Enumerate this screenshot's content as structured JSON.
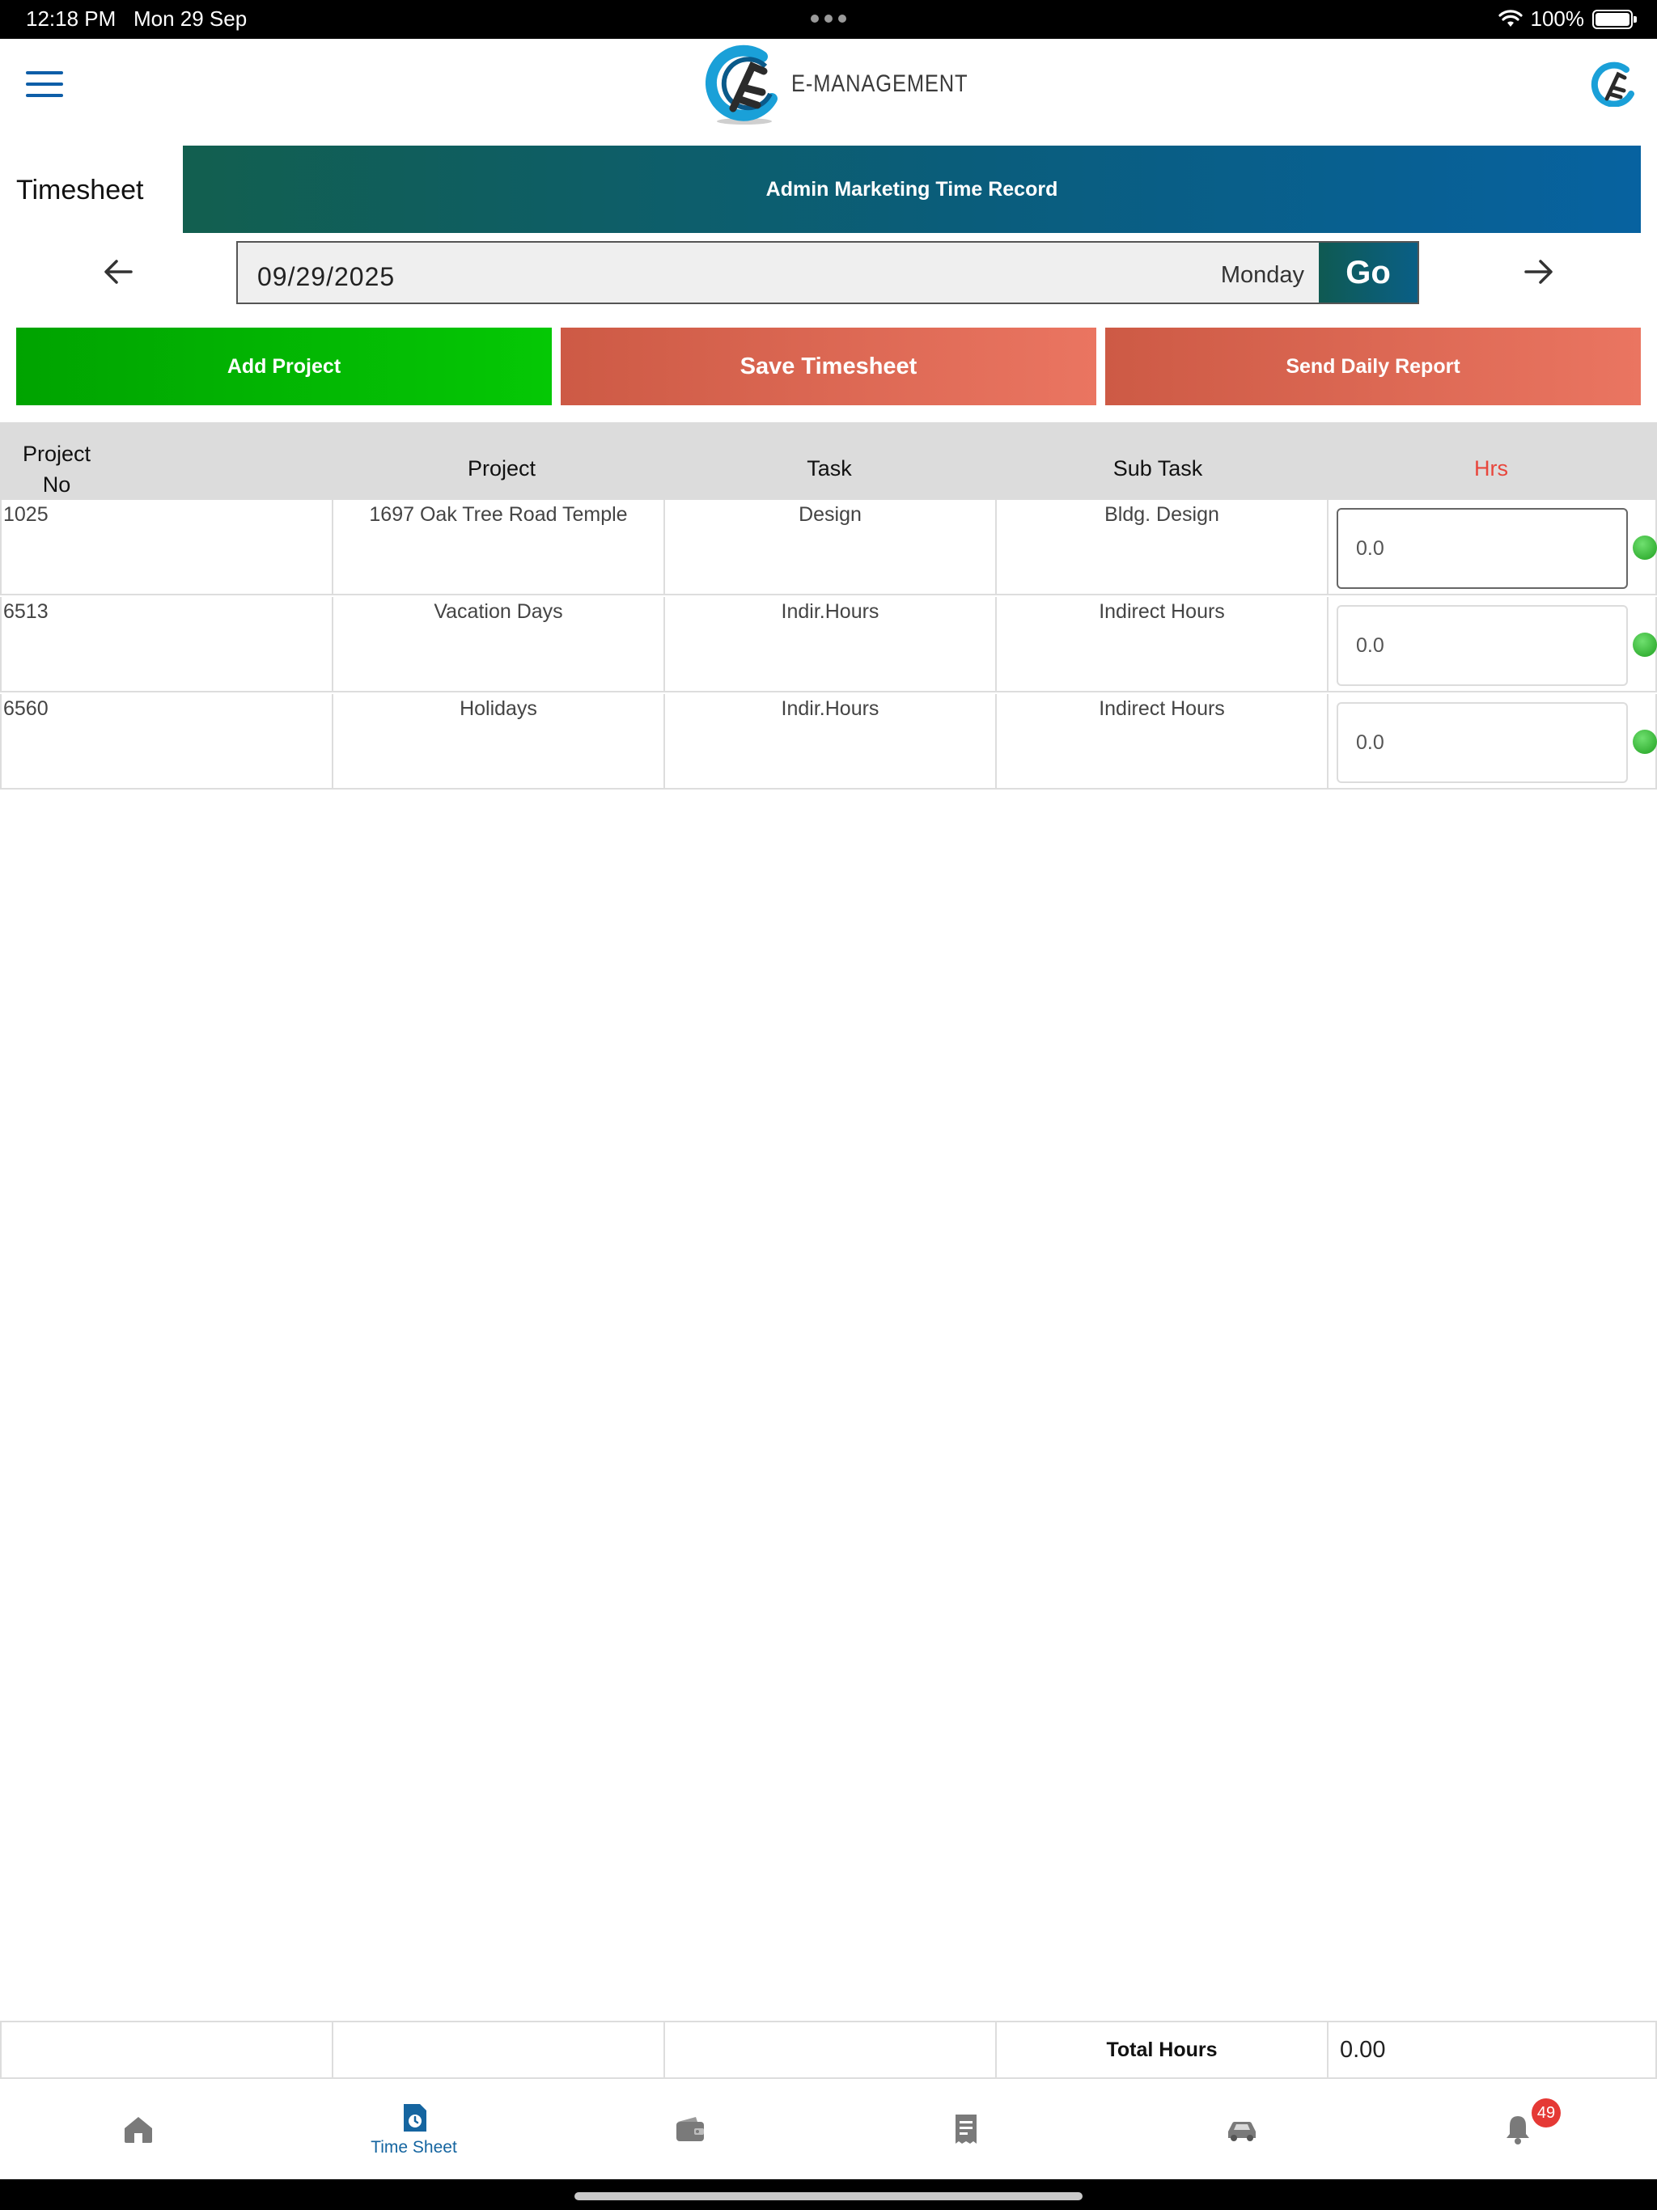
{
  "status_bar": {
    "time": "12:18 PM",
    "date": "Mon 29 Sep",
    "battery": "100%"
  },
  "header": {
    "app_name": "E-MANAGEMENT",
    "menu_icon": "hamburger-menu-icon",
    "avatar_icon": "profile-logo-icon"
  },
  "page": {
    "title": "Timesheet",
    "banner": "Admin Marketing Time Record"
  },
  "date_nav": {
    "date": "09/29/2025",
    "day": "Monday",
    "go_label": "Go",
    "prev_icon": "arrow-left-icon",
    "next_icon": "arrow-right-icon"
  },
  "actions": {
    "add_project": "Add Project",
    "save_timesheet": "Save Timesheet",
    "send_report": "Send Daily Report"
  },
  "table": {
    "headers": {
      "project_no_line1": "Project",
      "project_no_line2": "No",
      "project": "Project",
      "task": "Task",
      "sub_task": "Sub Task",
      "hrs": "Hrs"
    },
    "rows": [
      {
        "project_no": "1025",
        "project": "1697 Oak Tree Road Temple",
        "task": "Design",
        "sub_task": "Bldg. Design",
        "hrs": "0.0"
      },
      {
        "project_no": "6513",
        "project": "Vacation Days",
        "task": "Indir.Hours",
        "sub_task": "Indirect Hours",
        "hrs": "0.0"
      },
      {
        "project_no": "6560",
        "project": "Holidays",
        "task": "Indir.Hours",
        "sub_task": "Indirect Hours",
        "hrs": "0.0"
      }
    ]
  },
  "totals": {
    "label": "Total Hours",
    "value": "0.00"
  },
  "bottom_nav": {
    "items": [
      {
        "icon": "home-icon",
        "label": ""
      },
      {
        "icon": "timesheet-icon",
        "label": "Time Sheet"
      },
      {
        "icon": "wallet-icon",
        "label": ""
      },
      {
        "icon": "receipt-icon",
        "label": ""
      },
      {
        "icon": "car-icon",
        "label": ""
      },
      {
        "icon": "bell-icon",
        "label": ""
      }
    ],
    "notification_count": "49"
  },
  "colors": {
    "brand_blue": "#0e5ea8",
    "add_green": "#00a300",
    "save_red": "#cd5a45",
    "hrs_header_red": "#e8463c",
    "active_nav": "#1565a0",
    "inactive_nav": "#7a7a7a"
  }
}
